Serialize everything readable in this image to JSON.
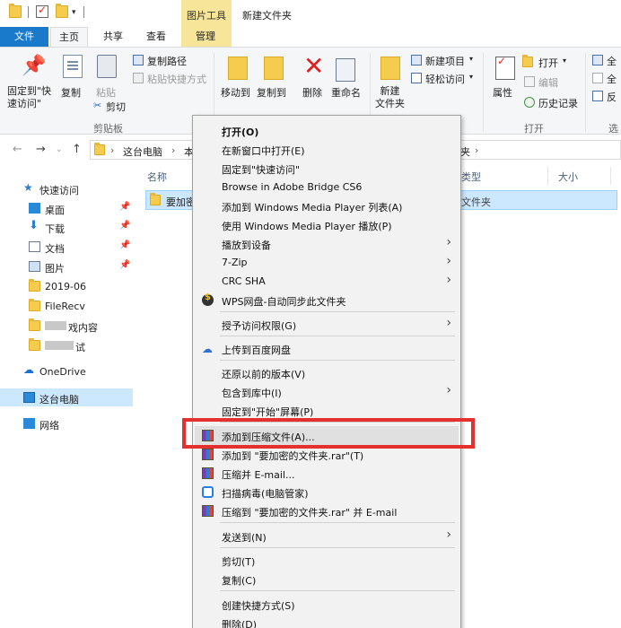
{
  "titlebar": {
    "context_tab": "图片工具",
    "window_title": "新建文件夹"
  },
  "tabs": {
    "file": "文件",
    "home": "主页",
    "share": "共享",
    "view": "查看",
    "manage": "管理"
  },
  "ribbon": {
    "pin_quick_access": "固定到\"快\n速访问\"",
    "copy": "复制",
    "paste": "粘贴",
    "copy_path": "复制路径",
    "paste_shortcut": "粘贴快捷方式",
    "cut": "剪切",
    "group_clipboard": "剪贴板",
    "move_to": "移动到",
    "copy_to": "复制到",
    "delete": "删除",
    "rename": "重命名",
    "new_folder": "新建\n文件夹",
    "new_item": "新建项目",
    "easy_access": "轻松访问",
    "properties": "属性",
    "open": "打开",
    "edit": "编辑",
    "history": "历史记录",
    "group_open": "打开",
    "select_all_partial": "全",
    "select_none_partial": "全",
    "invert_partial": "反",
    "group_select_partial": "选"
  },
  "address": {
    "crumb1": "这台电脑",
    "crumb2": "本",
    "crumb_tail": "夹",
    "tail_arrow": "›"
  },
  "navpane": {
    "quick_access": "快速访问",
    "desktop": "桌面",
    "downloads": "下载",
    "documents": "文档",
    "pictures": "图片",
    "folder_2019": "2019-06",
    "filerecv": "FileRecv",
    "folder_blur1": "戏内容",
    "folder_blur2": "试",
    "onedrive": "OneDrive",
    "this_pc": "这台电脑",
    "network": "网络"
  },
  "content": {
    "col_name": "名称",
    "col_type": "类型",
    "col_size": "大小",
    "file_name_partial": "要加密",
    "file_type": "文件夹"
  },
  "menu": {
    "open": "打开(O)",
    "open_new_window": "在新窗口中打开(E)",
    "pin_quick_access": "固定到\"快速访问\"",
    "browse_bridge": "Browse in Adobe Bridge CS6",
    "add_wmp_list": "添加到 Windows Media Player 列表(A)",
    "play_wmp": "使用 Windows Media Player 播放(P)",
    "cast_to_device": "播放到设备",
    "seven_zip": "7-Zip",
    "crc_sha": "CRC SHA",
    "wps_sync": "WPS网盘-自动同步此文件夹",
    "grant_access": "授予访问权限(G)",
    "upload_baidu": "上传到百度网盘",
    "restore_prev": "还原以前的版本(V)",
    "include_library": "包含到库中(I)",
    "pin_start": "固定到\"开始\"屏幕(P)",
    "add_archive": "添加到压缩文件(A)...",
    "add_to_rar": "添加到 \"要加密的文件夹.rar\"(T)",
    "compress_email": "压缩并 E-mail...",
    "scan_virus": "扫描病毒(电脑管家)",
    "compress_rar_email": "压缩到 \"要加密的文件夹.rar\" 并 E-mail",
    "send_to": "发送到(N)",
    "cut": "剪切(T)",
    "copy": "复制(C)",
    "create_shortcut": "创建快捷方式(S)",
    "delete": "删除(D)"
  },
  "colors": {
    "accent": "#1979ca",
    "highlight_box": "#e53030",
    "selection": "#cce8ff"
  }
}
